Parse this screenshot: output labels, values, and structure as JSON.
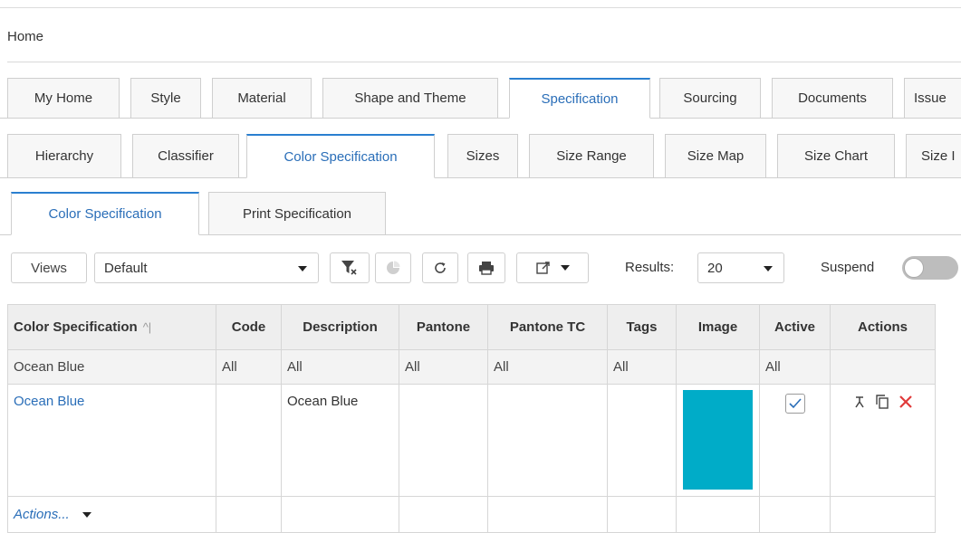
{
  "breadcrumb": "Home",
  "main_tabs": [
    {
      "label": "My Home"
    },
    {
      "label": "Style"
    },
    {
      "label": "Material"
    },
    {
      "label": "Shape and Theme"
    },
    {
      "label": "Specification"
    },
    {
      "label": "Sourcing"
    },
    {
      "label": "Documents"
    },
    {
      "label": "Issue"
    }
  ],
  "sub_tabs": [
    {
      "label": "Hierarchy"
    },
    {
      "label": "Classifier"
    },
    {
      "label": "Color Specification"
    },
    {
      "label": "Sizes"
    },
    {
      "label": "Size Range"
    },
    {
      "label": "Size Map"
    },
    {
      "label": "Size Chart"
    },
    {
      "label": "Size I"
    }
  ],
  "third_tabs": [
    {
      "label": "Color Specification"
    },
    {
      "label": "Print Specification"
    }
  ],
  "toolbar": {
    "views_label": "Views",
    "view_select_value": "Default",
    "results_label": "Results:",
    "results_value": "20",
    "suspend_label": "Suspend"
  },
  "table": {
    "headers": [
      "Color Specification",
      "Code",
      "Description",
      "Pantone",
      "Pantone TC",
      "Tags",
      "Image",
      "Active",
      "Actions"
    ],
    "filter_row": [
      "Ocean Blue",
      "All",
      "All",
      "All",
      "All",
      "All",
      "",
      "All",
      ""
    ],
    "rows": [
      {
        "name": "Ocean Blue",
        "code": "",
        "description": "Ocean Blue",
        "pantone": "",
        "pantone_tc": "",
        "tags": "",
        "image_color": "#00acc8",
        "active": true
      }
    ],
    "footer_action": "Actions..."
  },
  "colors": {
    "accent": "#2a6eb8",
    "delete_icon": "#e03a3a",
    "swatch": "#00acc8"
  }
}
